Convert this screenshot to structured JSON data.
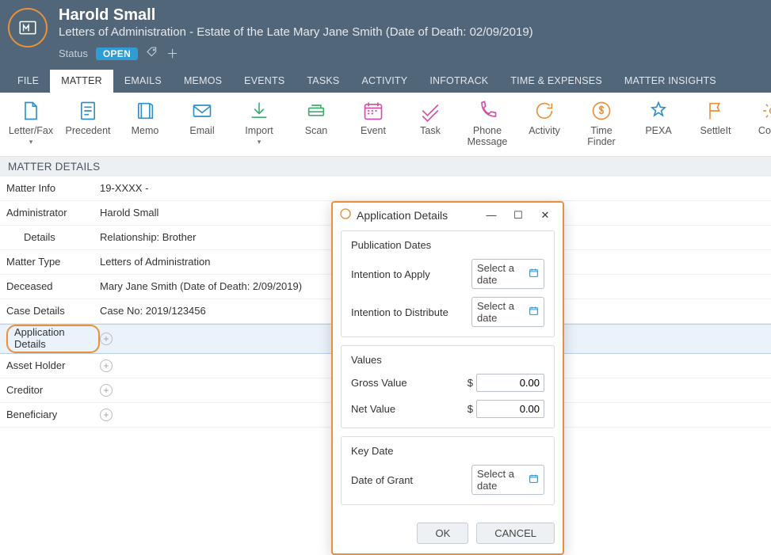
{
  "header": {
    "person": "Harold Small",
    "subtitle": "Letters of Administration - Estate of the Late Mary Jane Smith (Date of Death: 02/09/2019)",
    "status_label": "Status",
    "status_value": "OPEN"
  },
  "tabs": [
    "FILE",
    "MATTER",
    "EMAILS",
    "MEMOS",
    "EVENTS",
    "TASKS",
    "ACTIVITY",
    "INFOTRACK",
    "TIME & EXPENSES",
    "MATTER INSIGHTS"
  ],
  "active_tab": 1,
  "toolbar": [
    {
      "label": "Letter/Fax",
      "color": "#2f8fc9",
      "caret": true,
      "icon": "doc-fold"
    },
    {
      "label": "Precedent",
      "color": "#2f8fc9",
      "icon": "doc-lines"
    },
    {
      "label": "Memo",
      "color": "#2f8fc9",
      "icon": "notebook"
    },
    {
      "label": "Email",
      "color": "#2f8fc9",
      "icon": "mail"
    },
    {
      "label": "Import",
      "color": "#3aaf6d",
      "caret": true,
      "icon": "download"
    },
    {
      "label": "Scan",
      "color": "#3aaf6d",
      "icon": "scanner"
    },
    {
      "label": "Event",
      "color": "#d24fa7",
      "icon": "calendar"
    },
    {
      "label": "Task",
      "color": "#d24fa7",
      "icon": "check"
    },
    {
      "label": "Phone\nMessage",
      "color": "#d24fa7",
      "icon": "phone"
    },
    {
      "label": "Activity",
      "color": "#e8903a",
      "icon": "refresh"
    },
    {
      "label": "Time\nFinder",
      "color": "#e8903a",
      "icon": "clock-dollar"
    },
    {
      "label": "PEXA",
      "color": "#2f8fc9",
      "icon": "star"
    },
    {
      "label": "SettleIt",
      "color": "#e8903a",
      "icon": "flag"
    },
    {
      "label": "Config",
      "color": "#e8903a",
      "icon": "gear"
    }
  ],
  "section_title": "MATTER DETAILS",
  "rows": [
    {
      "label": "Matter Info",
      "value": "19-XXXX -"
    },
    {
      "label": "Administrator",
      "value": "Harold Small"
    },
    {
      "label": "Details",
      "value": "Relationship: Brother",
      "indent": true
    },
    {
      "label": "Matter Type",
      "value": "Letters of Administration"
    },
    {
      "label": "Deceased",
      "value": "Mary Jane Smith (Date of Death: 2/09/2019)"
    },
    {
      "label": "Case Details",
      "value": "Case No: 2019/123456"
    },
    {
      "label": "Application Details",
      "add": true,
      "highlight": true,
      "pill": true
    },
    {
      "label": "Asset Holder",
      "add": true
    },
    {
      "label": "Creditor",
      "add": true
    },
    {
      "label": "Beneficiary",
      "add": true
    }
  ],
  "dialog": {
    "title": "Application Details",
    "groups": {
      "pub": {
        "title": "Publication Dates",
        "fields": [
          {
            "label": "Intention to Apply",
            "type": "date",
            "placeholder": "Select a date"
          },
          {
            "label": "Intention to Distribute",
            "type": "date",
            "placeholder": "Select a date"
          }
        ]
      },
      "vals": {
        "title": "Values",
        "fields": [
          {
            "label": "Gross Value",
            "type": "money",
            "value": "0.00"
          },
          {
            "label": "Net Value",
            "type": "money",
            "value": "0.00"
          }
        ]
      },
      "key": {
        "title": "Key Date",
        "fields": [
          {
            "label": "Date of Grant",
            "type": "date",
            "placeholder": "Select a date"
          }
        ]
      }
    },
    "ok": "OK",
    "cancel": "CANCEL"
  }
}
